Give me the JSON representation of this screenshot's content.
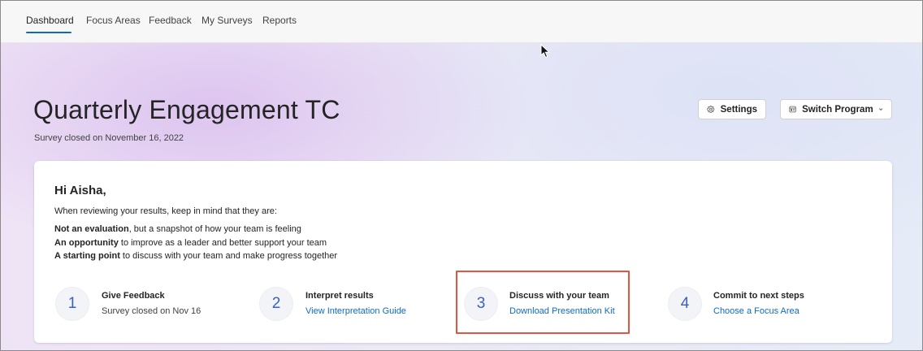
{
  "nav": {
    "items": [
      {
        "label": "Dashboard",
        "active": true
      },
      {
        "label": "Focus Areas",
        "active": false
      },
      {
        "label": "Feedback",
        "active": false
      },
      {
        "label": "My Surveys",
        "active": false
      },
      {
        "label": "Reports",
        "active": false
      }
    ]
  },
  "header": {
    "title": "Quarterly Engagement TC",
    "subtitle": "Survey closed on November 16, 2022",
    "settings_label": "Settings",
    "switch_program_label": "Switch Program"
  },
  "card": {
    "greeting": "Hi Aisha,",
    "intro": "When reviewing your results, keep in mind that they are:",
    "points": [
      {
        "bold": "Not an evaluation",
        "rest": ", but a snapshot of how your team is feeling"
      },
      {
        "bold": "An opportunity",
        "rest": " to improve as a leader and better support your team"
      },
      {
        "bold": "A starting point",
        "rest": " to discuss with your team and make progress together"
      }
    ],
    "steps": [
      {
        "number": "1",
        "title": "Give Feedback",
        "sub": "Survey closed on Nov 16"
      },
      {
        "number": "2",
        "title": "Interpret results",
        "link": "View Interpretation Guide"
      },
      {
        "number": "3",
        "title": "Discuss with your team",
        "link": "Download Presentation Kit"
      },
      {
        "number": "4",
        "title": "Commit to next steps",
        "link": "Choose a Focus Area"
      }
    ]
  },
  "colors": {
    "accent": "#0f6cbd",
    "highlight": "#e4543e",
    "step_number": "#3b5fbf"
  }
}
